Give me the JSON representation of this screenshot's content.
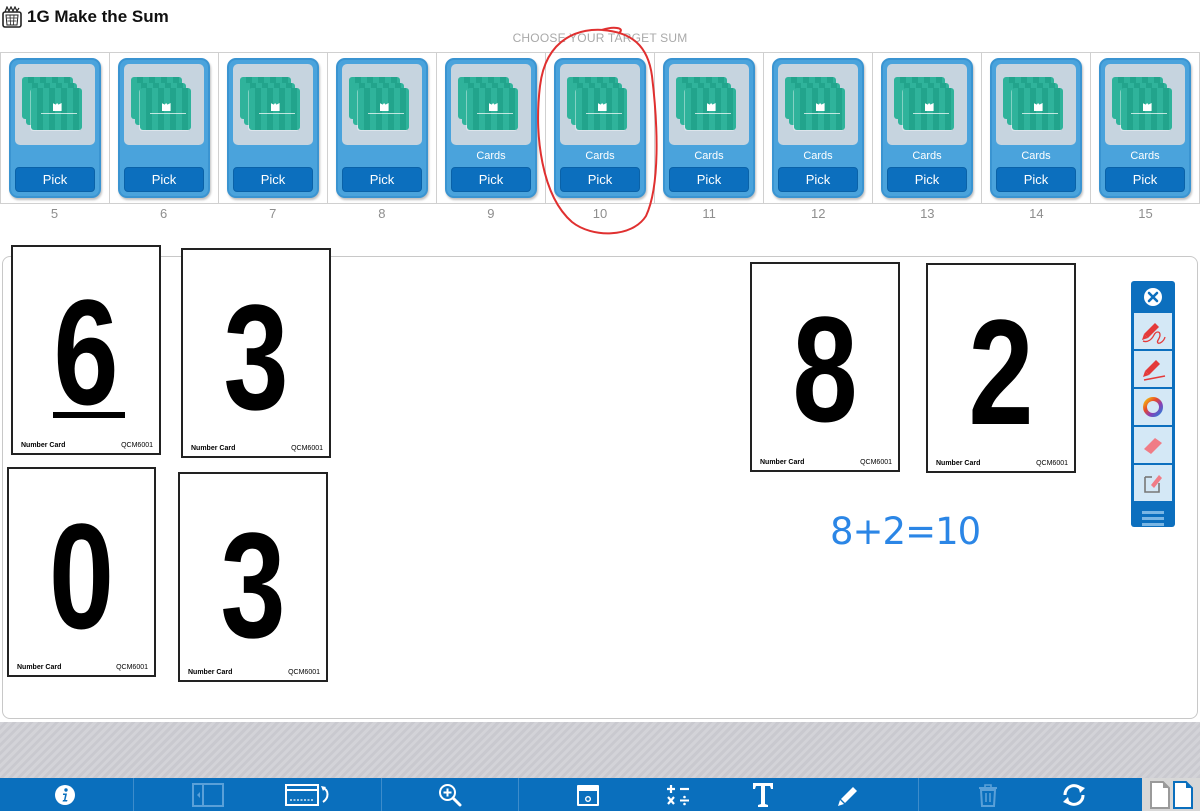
{
  "app": {
    "title": "1G Make the Sum",
    "title_icon": "activity-basket-icon"
  },
  "deck_picker": {
    "heading": "CHOOSE YOUR TARGET SUM",
    "decks": [
      {
        "sum": "5",
        "label": "",
        "button": "Pick"
      },
      {
        "sum": "6",
        "label": "",
        "button": "Pick"
      },
      {
        "sum": "7",
        "label": "",
        "button": "Pick"
      },
      {
        "sum": "8",
        "label": "",
        "button": "Pick"
      },
      {
        "sum": "9",
        "label": "Cards",
        "button": "Pick"
      },
      {
        "sum": "10",
        "label": "Cards",
        "button": "Pick",
        "annotated": true
      },
      {
        "sum": "11",
        "label": "Cards",
        "button": "Pick"
      },
      {
        "sum": "12",
        "label": "Cards",
        "button": "Pick"
      },
      {
        "sum": "13",
        "label": "Cards",
        "button": "Pick"
      },
      {
        "sum": "14",
        "label": "Cards",
        "button": "Pick"
      },
      {
        "sum": "15",
        "label": "Cards",
        "button": "Pick"
      }
    ]
  },
  "workspace": {
    "cards": [
      {
        "value": "6",
        "underlined": true,
        "caption": "Number Card",
        "code": "QCM6001"
      },
      {
        "value": "3",
        "underlined": false,
        "caption": "Number Card",
        "code": "QCM6001"
      },
      {
        "value": "0",
        "underlined": false,
        "caption": "Number Card",
        "code": "QCM6001"
      },
      {
        "value": "3",
        "underlined": false,
        "caption": "Number Card",
        "code": "QCM6001"
      },
      {
        "value": "8",
        "underlined": false,
        "caption": "Number Card",
        "code": "QCM6001"
      },
      {
        "value": "2",
        "underlined": false,
        "caption": "Number Card",
        "code": "QCM6001"
      }
    ],
    "handwritten_equation": "8+2=10",
    "annotation_color": "#e03030",
    "equation_color": "#2b86e6"
  },
  "pen_toolbar": {
    "tools": [
      "close-icon",
      "freehand-pen-icon",
      "line-pen-icon",
      "color-wheel-icon",
      "eraser-icon",
      "clear-note-icon",
      "menu-icon"
    ]
  },
  "bottom_toolbar": {
    "buttons": [
      "info",
      "side-panel",
      "screen-reset",
      "zoom-in",
      "calendar",
      "math-operations",
      "text",
      "pencil",
      "trash",
      "refresh",
      "page-view"
    ],
    "brand_color": "#0a6fbd"
  }
}
